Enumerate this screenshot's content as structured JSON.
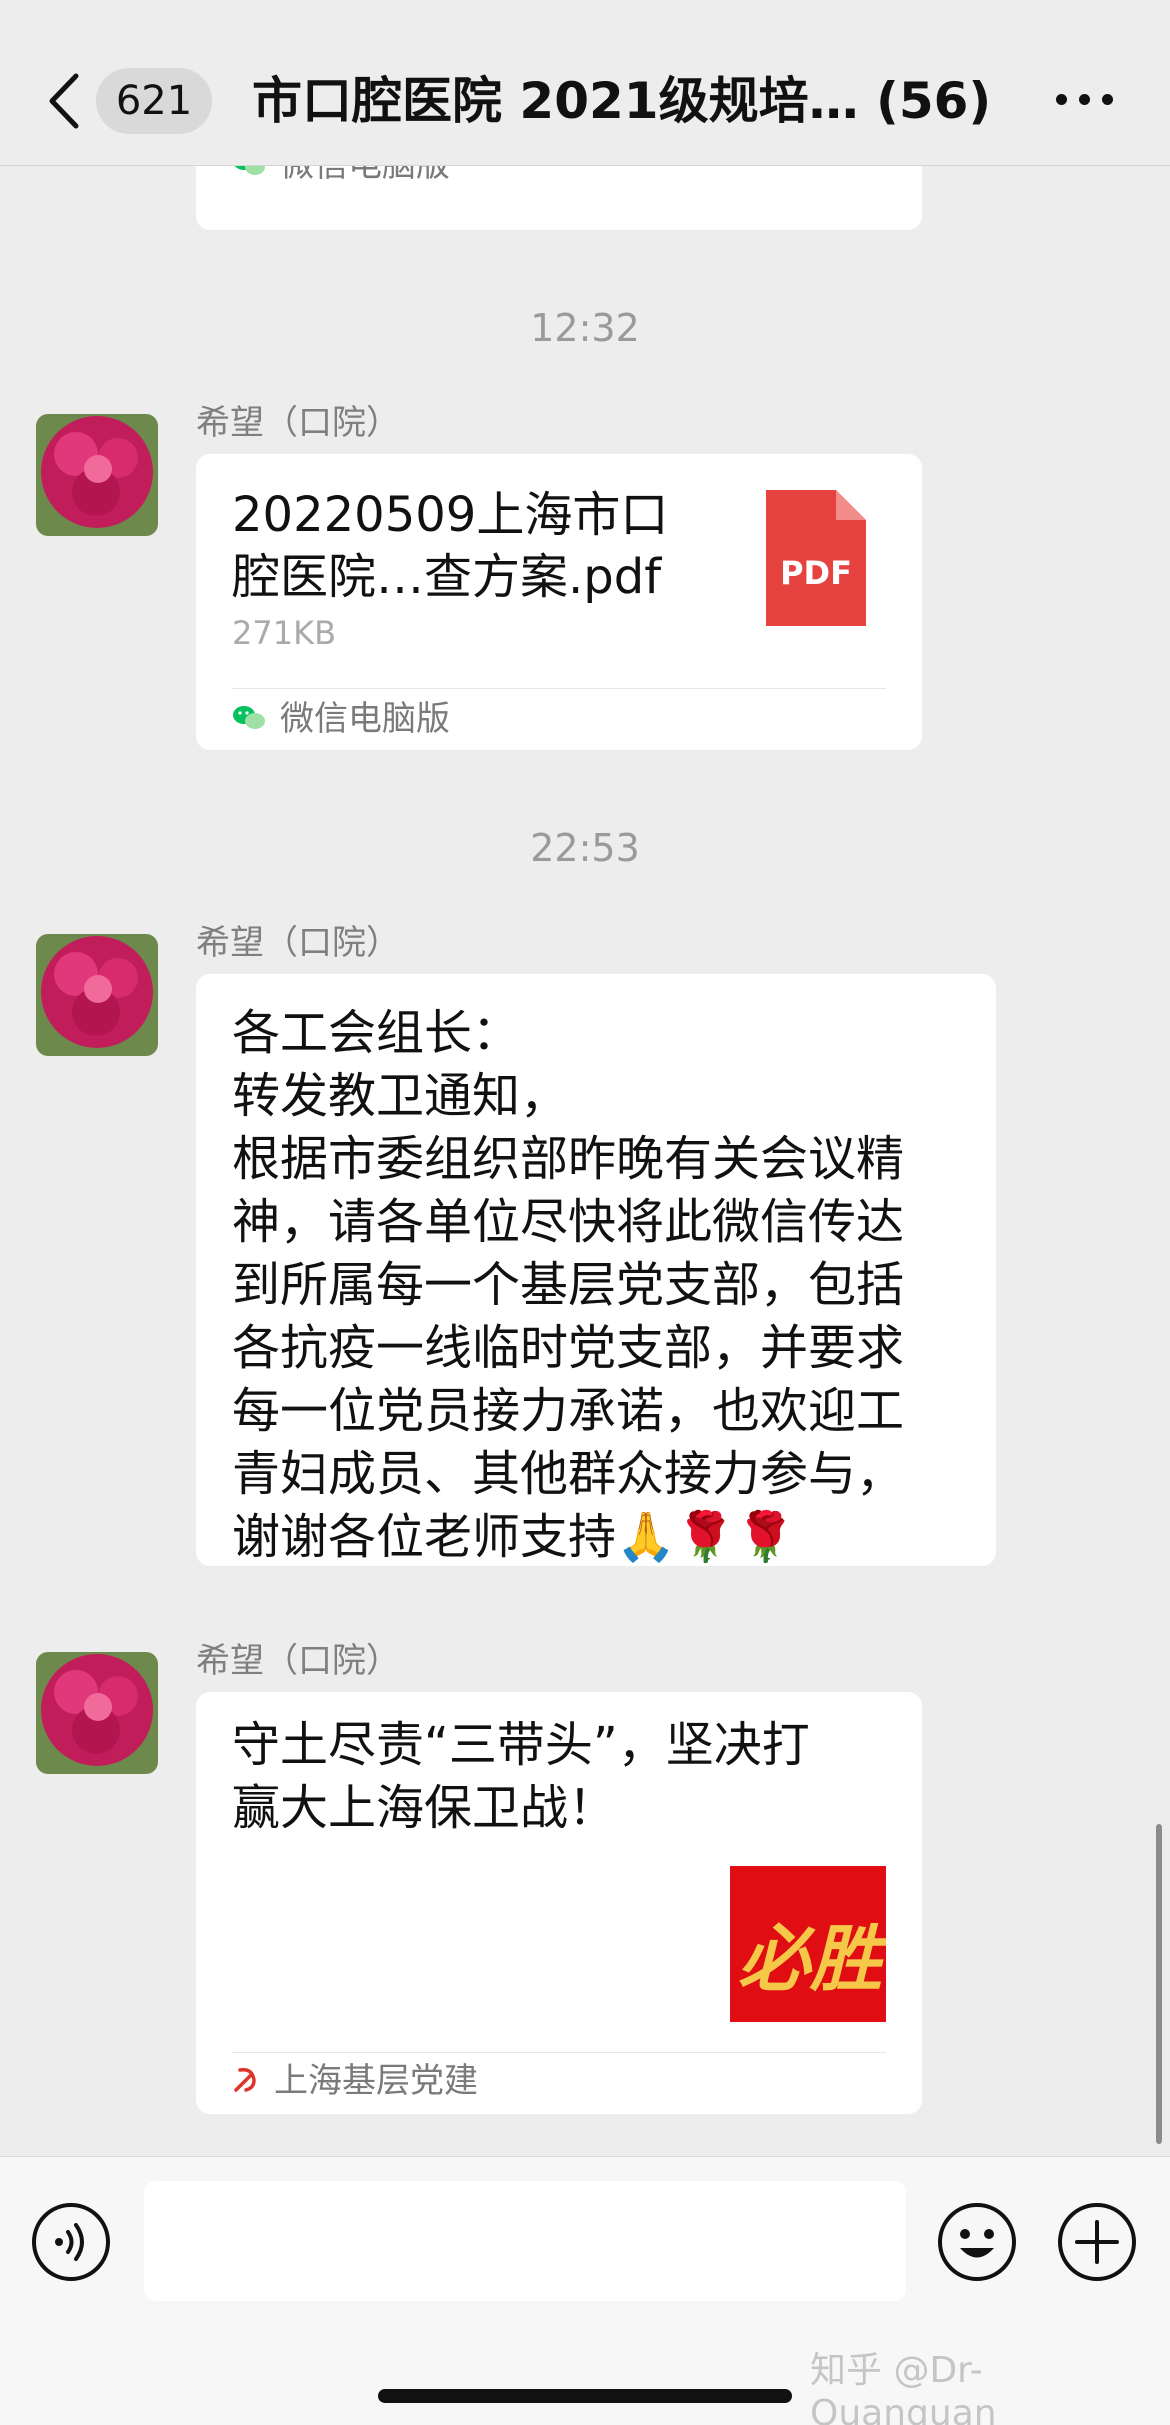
{
  "header": {
    "unread_count": "621",
    "title": "市口腔医院 2021级规培… (56)"
  },
  "messages": {
    "top_source": "微信电脑版",
    "time_1": "12:32",
    "sender_1": "希望（口院）",
    "file": {
      "name": "20220509上海市口腔医院…查方案.pdf",
      "size": "271KB",
      "badge": "PDF",
      "source": "微信电脑版"
    },
    "time_2": "22:53",
    "sender_2": "希望（口院）",
    "notice_text": "各工会组长：\n转发教卫通知，\n根据市委组织部昨晚有关会议精\n神，请各单位尽快将此微信传达\n到所属每一个基层党支部，包括\n各抗疫一线临时党支部，并要求\n每一位党员接力承诺，也欢迎工\n青妇成员、其他群众接力参与，\n谢谢各位老师支持🙏🌹🌹",
    "sender_3": "希望（口院）",
    "link": {
      "title": "守土尽责“三带头”，坚决打\n赢大上海保卫战！",
      "thumb_text": "必胜",
      "source": "上海基层党建"
    }
  },
  "input": {
    "placeholder": ""
  },
  "watermark": "知乎 @Dr-Quanquan",
  "colors": {
    "wechat_green": "#07c160",
    "pdf_red": "#e64340",
    "link_thumb_red": "#e00d12"
  }
}
